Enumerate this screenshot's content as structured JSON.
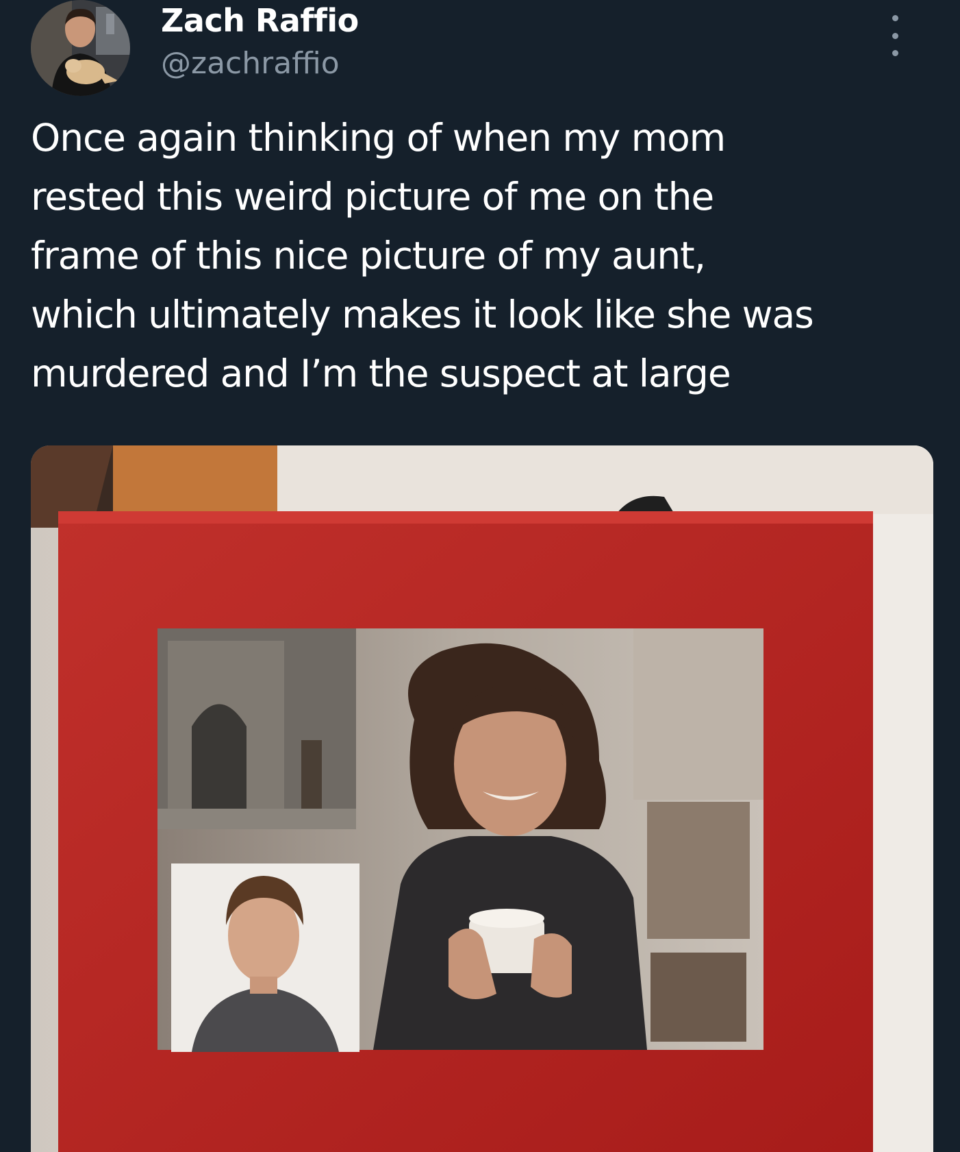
{
  "author": {
    "display_name": "Zach Raffio",
    "handle": "@zachraffio"
  },
  "tweet": {
    "text": "Once again thinking of when my mom\nrested this weird picture of me on the\nframe of this nice picture of my aunt,\nwhich ultimately makes it look like she was\nmurdered and I’m the suspect at large"
  },
  "icons": {
    "more": "more-dots-icon"
  },
  "colors": {
    "background": "#15202b",
    "text": "#ffffff",
    "secondary_text": "#8b98a5",
    "frame_red": "#b8221f"
  }
}
